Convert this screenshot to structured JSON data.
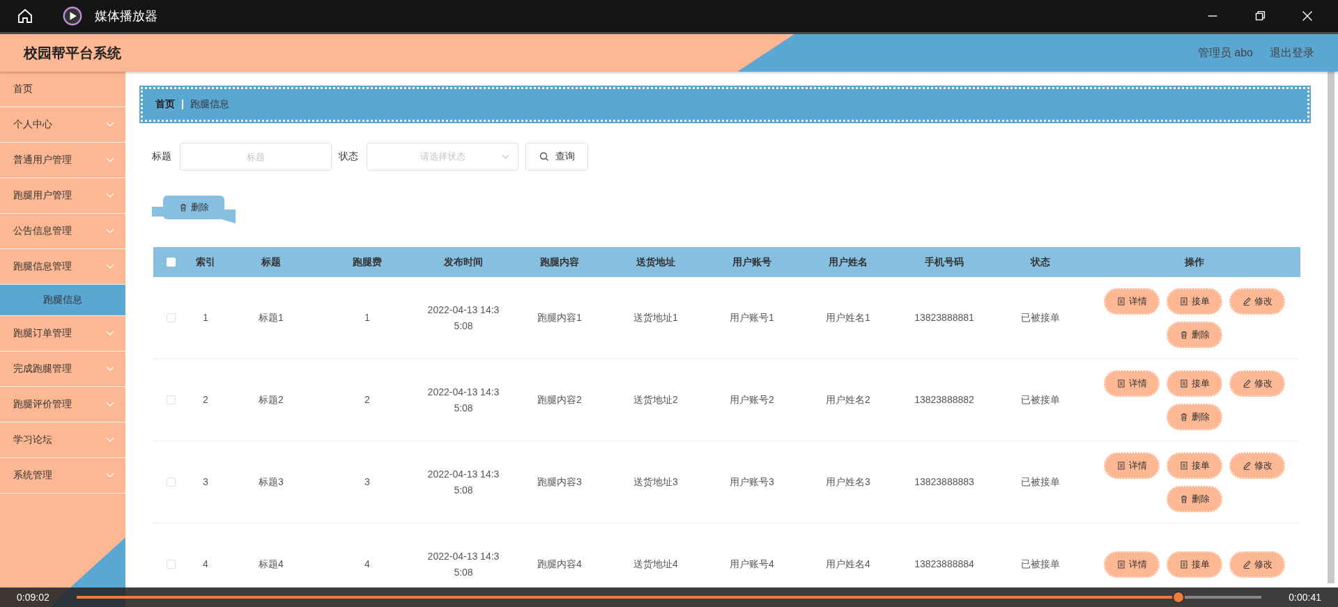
{
  "player": {
    "title": "媒体播放器",
    "elapsed": "0:09:02",
    "remaining": "0:00:41",
    "level": 0.92
  },
  "app": {
    "title": "校园帮平台系统",
    "user": "管理员 abo",
    "logout": "退出登录"
  },
  "sidebar": {
    "items": [
      {
        "label": "首页",
        "kind": "link",
        "selected": false
      },
      {
        "label": "个人中心",
        "kind": "menu",
        "selected": false
      },
      {
        "label": "普通用户管理",
        "kind": "menu",
        "selected": false
      },
      {
        "label": "跑腿用户管理",
        "kind": "menu",
        "selected": false
      },
      {
        "label": "公告信息管理",
        "kind": "menu",
        "selected": false
      },
      {
        "label": "跑腿信息管理",
        "kind": "menu",
        "selected": false,
        "children": [
          {
            "label": "跑腿信息",
            "selected": true
          }
        ]
      },
      {
        "label": "跑腿订单管理",
        "kind": "menu",
        "selected": false
      },
      {
        "label": "完成跑腿管理",
        "kind": "menu",
        "selected": false
      },
      {
        "label": "跑腿评价管理",
        "kind": "menu",
        "selected": false
      },
      {
        "label": "学习论坛",
        "kind": "menu",
        "selected": false
      },
      {
        "label": "系统管理",
        "kind": "menu",
        "selected": false
      }
    ]
  },
  "breadcrumb": [
    "首页",
    "跑腿信息"
  ],
  "search": {
    "fields": [
      {
        "label": "标题",
        "placeholder": "标题",
        "kind": "input"
      },
      {
        "label": "状态",
        "placeholder": "请选择状态",
        "kind": "select"
      }
    ],
    "button": "查询"
  },
  "toolbar": {
    "delete_button": "删除"
  },
  "table": {
    "header_checked": false,
    "columns": [
      "索引",
      "标题",
      "跑腿费",
      "发布时间",
      "跑腿内容",
      "送货地址",
      "用户账号",
      "用户姓名",
      "手机号码",
      "状态",
      "操作"
    ],
    "rows": [
      {
        "checked": false,
        "cells": [
          "1",
          "标题1",
          "1",
          "2022-04-13 14:35:08",
          "跑腿内容1",
          "送货地址1",
          "用户账号1",
          "用户姓名1",
          "13823888881",
          "已被接单"
        ],
        "actions": [
          {
            "label": "详情",
            "kind": "detail"
          },
          {
            "label": "接单",
            "kind": "accept"
          },
          {
            "label": "修改",
            "kind": "edit"
          },
          {
            "label": "删除",
            "kind": "delete"
          }
        ]
      },
      {
        "checked": false,
        "cells": [
          "2",
          "标题2",
          "2",
          "2022-04-13 14:35:08",
          "跑腿内容2",
          "送货地址2",
          "用户账号2",
          "用户姓名2",
          "13823888882",
          "已被接单"
        ],
        "actions": [
          {
            "label": "详情",
            "kind": "detail"
          },
          {
            "label": "接单",
            "kind": "accept"
          },
          {
            "label": "修改",
            "kind": "edit"
          },
          {
            "label": "删除",
            "kind": "delete"
          }
        ]
      },
      {
        "checked": false,
        "cells": [
          "3",
          "标题3",
          "3",
          "2022-04-13 14:35:08",
          "跑腿内容3",
          "送货地址3",
          "用户账号3",
          "用户姓名3",
          "13823888883",
          "已被接单"
        ],
        "actions": [
          {
            "label": "详情",
            "kind": "detail"
          },
          {
            "label": "接单",
            "kind": "accept"
          },
          {
            "label": "修改",
            "kind": "edit"
          },
          {
            "label": "删除",
            "kind": "delete"
          }
        ]
      },
      {
        "checked": false,
        "cells": [
          "4",
          "标题4",
          "4",
          "2022-04-13 14:35:08",
          "跑腿内容4",
          "送货地址4",
          "用户账号4",
          "用户姓名4",
          "13823888884",
          "已被接单"
        ],
        "actions": [
          {
            "label": "详情",
            "kind": "detail"
          },
          {
            "label": "接单",
            "kind": "accept"
          },
          {
            "label": "修改",
            "kind": "edit"
          }
        ]
      }
    ]
  }
}
